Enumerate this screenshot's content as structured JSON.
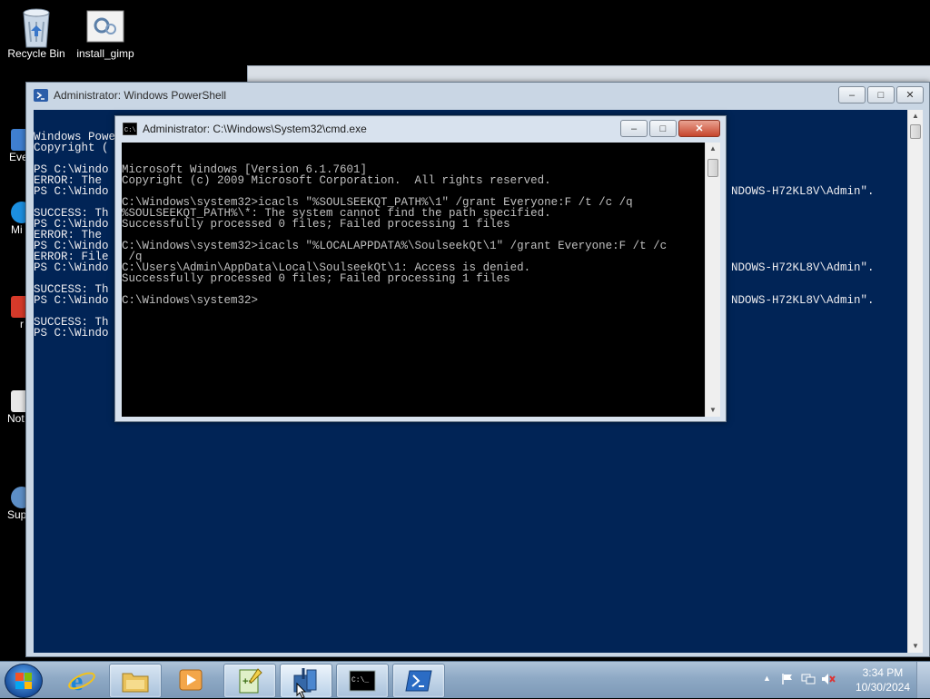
{
  "desktop": {
    "icons": [
      {
        "label": "Recycle Bin"
      },
      {
        "label": "install_gimp"
      }
    ],
    "partial_labels": [
      "Eve",
      "Mi",
      "r",
      "Not",
      "Sup"
    ]
  },
  "powershell": {
    "title": "Administrator: Windows PowerShell",
    "lines": [
      "Windows PowerShell",
      "Copyright (",
      "",
      "PS C:\\Windo",
      "ERROR: The",
      "PS C:\\Windo",
      "",
      "SUCCESS: Th",
      "PS C:\\Windo",
      "ERROR: The",
      "PS C:\\Windo",
      "ERROR: File",
      "PS C:\\Windo",
      "",
      "SUCCESS: Th",
      "PS C:\\Windo",
      "",
      "SUCCESS: Th",
      "PS C:\\Windo"
    ],
    "right_fragments": [
      "NDOWS-H72KL8V\\Admin\".",
      "NDOWS-H72KL8V\\Admin\".",
      "NDOWS-H72KL8V\\Admin\"."
    ]
  },
  "cmd": {
    "title": "Administrator: C:\\Windows\\System32\\cmd.exe",
    "lines": [
      "Microsoft Windows [Version 6.1.7601]",
      "Copyright (c) 2009 Microsoft Corporation.  All rights reserved.",
      "",
      "C:\\Windows\\system32>icacls \"%SOULSEEKQT_PATH%\\1\" /grant Everyone:F /t /c /q",
      "%SOULSEEKQT_PATH%\\*: The system cannot find the path specified.",
      "Successfully processed 0 files; Failed processing 1 files",
      "",
      "C:\\Windows\\system32>icacls \"%LOCALAPPDATA%\\SoulseekQt\\1\" /grant Everyone:F /t /c",
      " /q",
      "C:\\Users\\Admin\\AppData\\Local\\SoulseekQt\\1: Access is denied.",
      "Successfully processed 0 files; Failed processing 1 files",
      "",
      "C:\\Windows\\system32>"
    ]
  },
  "window_controls": {
    "minimize": "–",
    "maximize": "□",
    "close": "✕"
  },
  "taskbar": {
    "items": [
      {
        "name": "internet-explorer",
        "icon": "ie-icon"
      },
      {
        "name": "windows-explorer",
        "icon": "folder-icon"
      },
      {
        "name": "media-player",
        "icon": "media-player-icon"
      },
      {
        "name": "notepad-plus-plus",
        "icon": "notepad-plus-plus-icon"
      },
      {
        "name": "installer",
        "icon": "installer-icon"
      },
      {
        "name": "cmd",
        "icon": "cmd-icon"
      },
      {
        "name": "powershell",
        "icon": "powershell-icon"
      }
    ],
    "time": "3:34 PM",
    "date": "10/30/2024"
  },
  "colors": {
    "powershell_bg": "#012456",
    "cmd_bg": "#000000",
    "desktop_bg": "#000000"
  }
}
